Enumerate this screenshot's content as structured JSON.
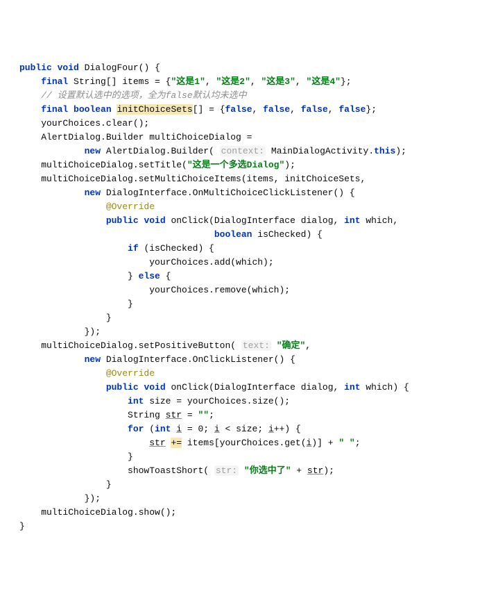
{
  "kw": {
    "public": "public",
    "void": "void",
    "final": "final",
    "boolean": "boolean",
    "new": "new",
    "int": "int",
    "if": "if",
    "else": "else",
    "for": "for",
    "this": "this"
  },
  "sig": {
    "name": "DialogFour",
    "lparen": "()",
    "lbrace": " {"
  },
  "l2": {
    "a": "    ",
    "b": " String[] items = {",
    "s1": "\"这是1\"",
    "c1": ", ",
    "s2": "\"这是2\"",
    "c2": ", ",
    "s3": "\"这是3\"",
    "c3": ", ",
    "s4": "\"这是4\"",
    "end": "};"
  },
  "l3": {
    "a": "    ",
    "text": "// 设置默认选中的选项，全为false默认均未选中"
  },
  "l4": {
    "a": "    ",
    "sp": " ",
    "name": "initChoiceSets",
    "b": "[] = {",
    "f": "false",
    "c": ", ",
    "end": "};"
  },
  "l5": {
    "a": "    yourChoices.clear();"
  },
  "l6": {
    "a": "    AlertDialog.Builder multiChoiceDialog ="
  },
  "l7": {
    "a": "            ",
    "b": " AlertDialog.Builder( ",
    "hint": "context:",
    "c": " MainDialogActivity.",
    "end": ");"
  },
  "l8": {
    "a": "    multiChoiceDialog.setTitle(",
    "s": "\"这是一个多选Dialog\"",
    "b": ");"
  },
  "l9": {
    "a": "    multiChoiceDialog.setMultiChoiceItems(items, initChoiceSets,"
  },
  "l10": {
    "a": "            ",
    "b": " DialogInterface.OnMultiChoiceClickListener() {"
  },
  "l11": {
    "a": "                ",
    "ann": "@Override"
  },
  "l12": {
    "a": "                ",
    "sp": " ",
    "b": " onClick(DialogInterface dialog, ",
    "c": " which,"
  },
  "l13": {
    "a": "                                    ",
    "b": " isChecked) {"
  },
  "l14": {
    "a": "                    ",
    "b": " (isChecked) {"
  },
  "l15": {
    "a": "                        yourChoices.add(which);"
  },
  "l16": {
    "a": "                    } ",
    "b": " {"
  },
  "l17": {
    "a": "                        yourChoices.remove(which);"
  },
  "l18": {
    "a": "                    }"
  },
  "l19": {
    "a": "                }"
  },
  "l20": {
    "a": "            });"
  },
  "l21": {
    "a": "    multiChoiceDialog.setPositiveButton( ",
    "hint": "text:",
    "sp": " ",
    "s": "\"确定\"",
    "b": ","
  },
  "l22": {
    "a": "            ",
    "b": " DialogInterface.OnClickListener() {"
  },
  "l23": {
    "a": "                ",
    "ann": "@Override"
  },
  "l24": {
    "a": "                ",
    "sp": " ",
    "b": " onClick(DialogInterface dialog, ",
    "c": " which) {"
  },
  "l25": {
    "a": "                    ",
    "b": " size = yourChoices.size();"
  },
  "l26": {
    "a": "                    String ",
    "u": "str",
    "b": " = ",
    "s": "\"\"",
    "c": ";"
  },
  "l27": {
    "a": "                    ",
    "b": " (",
    "c": " ",
    "u1": "i",
    "d": " = ",
    "z": "0",
    "e": "; ",
    "u2": "i",
    "f": " < size; ",
    "u3": "i",
    "g": "++) {"
  },
  "l28": {
    "a": "                        ",
    "u1": "str",
    "sp": " ",
    "op": "+=",
    "b": " items[yourChoices.get(",
    "u2": "i",
    "c": ")] + ",
    "s": "\" \"",
    "d": ";"
  },
  "l29": {
    "a": "                    }"
  },
  "l30": {
    "a": "                    showToastShort( ",
    "hint": "str:",
    "sp": " ",
    "s": "\"你选中了\"",
    "b": " + ",
    "u": "str",
    "c": ");"
  },
  "l31": {
    "a": "                }"
  },
  "l32": {
    "a": "            });"
  },
  "l33": {
    "a": "    multiChoiceDialog.show();"
  },
  "l34": {
    "a": "}"
  }
}
